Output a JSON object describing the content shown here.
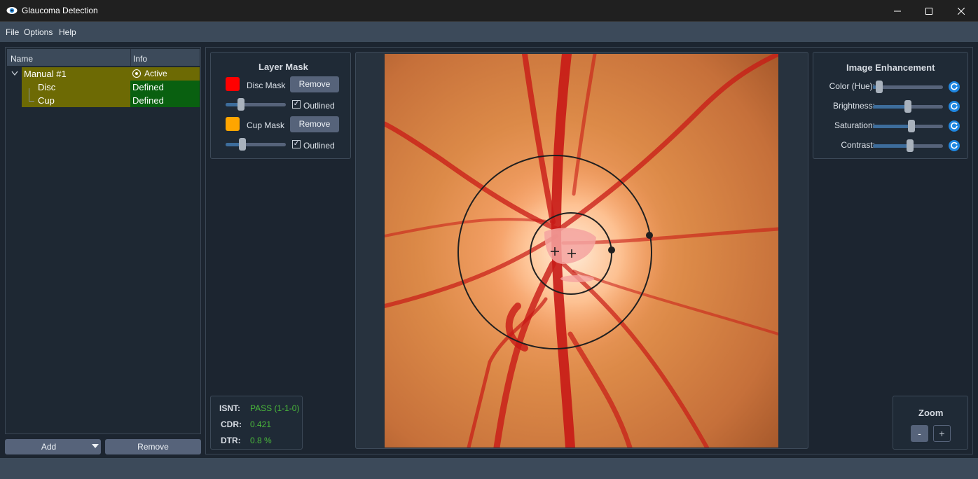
{
  "window": {
    "title": "Glaucoma Detection"
  },
  "menu": {
    "file": "File",
    "options": "Options",
    "help": "Help"
  },
  "tree": {
    "col_name": "Name",
    "col_info": "Info",
    "rows": [
      {
        "name": "Manual #1",
        "info": "Active"
      },
      {
        "name": "Disc",
        "info": "Defined"
      },
      {
        "name": "Cup",
        "info": "Defined"
      }
    ]
  },
  "left_buttons": {
    "add": "Add",
    "remove": "Remove"
  },
  "layer_mask": {
    "title": "Layer Mask",
    "disc": {
      "label": "Disc Mask",
      "color": "#ff0000",
      "remove": "Remove",
      "outlined": "Outlined",
      "checked": true,
      "opacity": 0.23
    },
    "cup": {
      "label": "Cup Mask",
      "color": "#ffa500",
      "remove": "Remove",
      "outlined": "Outlined",
      "checked": true,
      "opacity": 0.25
    }
  },
  "stats": {
    "isnt_label": "ISNT:",
    "isnt_value": "PASS (1-1-0)",
    "cdr_label": "CDR:",
    "cdr_value": "0.421",
    "dtr_label": "DTR:",
    "dtr_value": "0.8 %"
  },
  "enhancement": {
    "title": "Image Enhancement",
    "sliders": [
      {
        "label": "Color (Hue):",
        "value": 0.04
      },
      {
        "label": "Brightness:",
        "value": 0.5
      },
      {
        "label": "Saturation:",
        "value": 0.56
      },
      {
        "label": "Contrast:",
        "value": 0.53
      }
    ]
  },
  "zoom": {
    "title": "Zoom",
    "minus": "-",
    "plus": "+"
  },
  "colors": {
    "accent": "#1f86e0",
    "stat_green": "#4ab83b"
  }
}
